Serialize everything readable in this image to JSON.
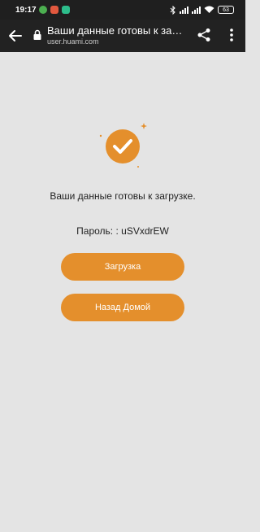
{
  "status_bar": {
    "time": "19:17",
    "battery": "63"
  },
  "browser": {
    "page_title": "Ваши данные готовы к загрузке",
    "url": "user.huami.com"
  },
  "main": {
    "message": "Ваши данные готовы к загрузке.",
    "password_line": "Пароль: : uSVxdrEW",
    "download_label": "Загрузка",
    "home_label": "Назад Домой"
  },
  "colors": {
    "accent": "#e48f2c",
    "background": "#e4e4e4",
    "toolbar": "#222222"
  },
  "icons": [
    "back-arrow-icon",
    "lock-icon",
    "share-icon",
    "more-vert-icon",
    "check-circle-icon",
    "sparkle-icon"
  ]
}
